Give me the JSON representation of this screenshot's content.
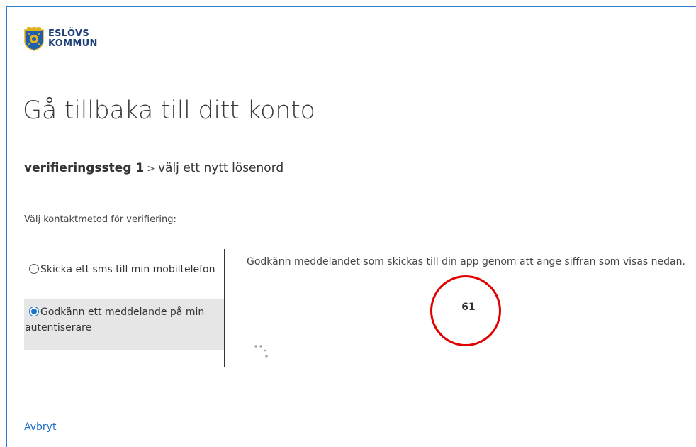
{
  "brand": {
    "name_line1": "ESLÖVS",
    "name_line2": "KOMMUN",
    "icon": "crest-icon"
  },
  "title": "Gå tillbaka till ditt konto",
  "steps": {
    "current": "verifieringssteg 1",
    "separator": ">",
    "next": "välj ett nytt lösenord"
  },
  "prompt": "Välj kontaktmetod för verifiering:",
  "methods": [
    {
      "label": "Skicka ett sms till min mobiltelefon",
      "selected": false
    },
    {
      "label": "Godkänn ett meddelande på min autentiserare",
      "selected": true
    }
  ],
  "instructions": "Godkänn meddelandet som skickas till din app genom att ange siffran som visas nedan.",
  "number": "61",
  "cancel_label": "Avbryt",
  "colors": {
    "accent": "#1a73c9",
    "frame": "#2f7dcf",
    "highlight_circle": "#e00000",
    "selected_bg": "#e6e6e6"
  }
}
